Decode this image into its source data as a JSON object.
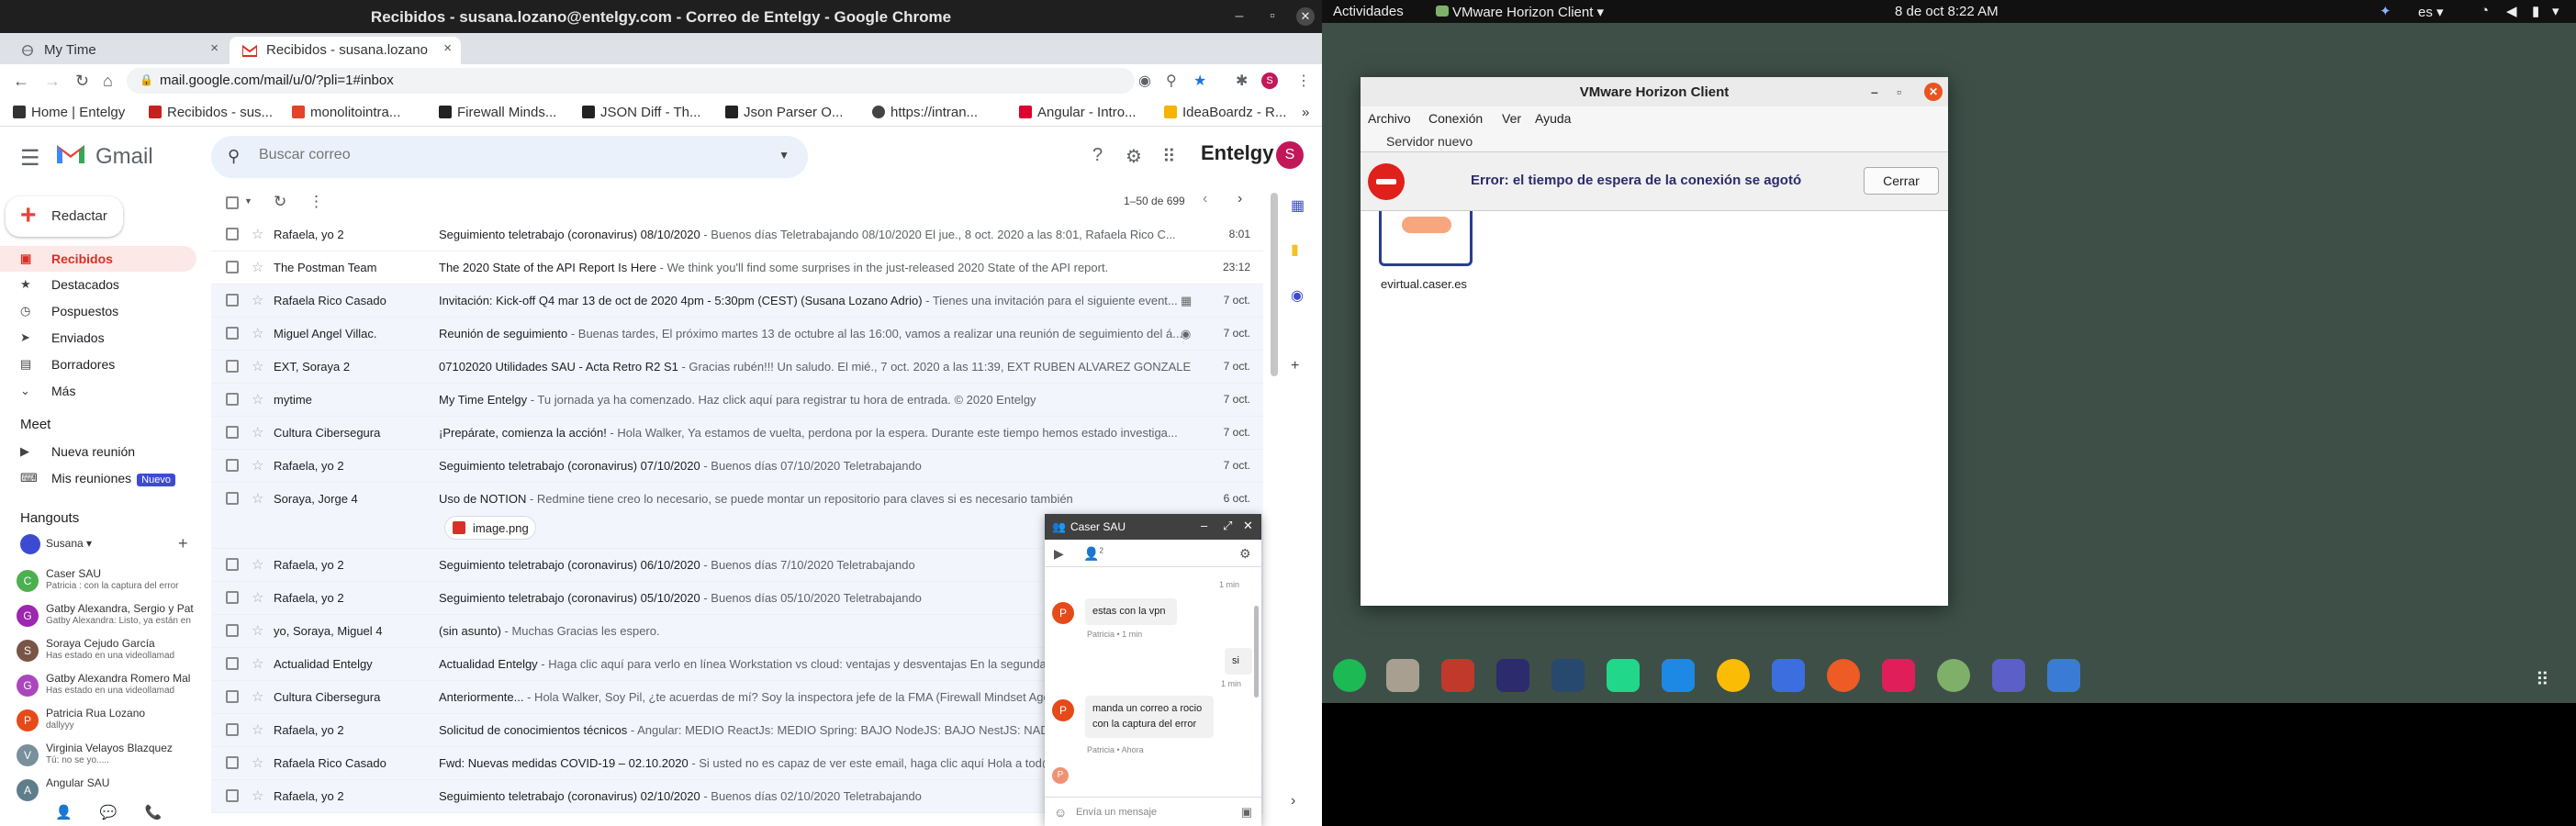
{
  "chrome": {
    "title": "Recibidos - susana.lozano@entelgy.com - Correo de Entelgy - Google Chrome",
    "tabs": [
      {
        "label": "My Time"
      },
      {
        "label": "Recibidos - susana.lozano"
      }
    ],
    "url": "mail.google.com/mail/u/0/?pli=1#inbox",
    "bookmarks": [
      {
        "label": "Home | Entelgy",
        "color": "#333"
      },
      {
        "label": "Recibidos - sus...",
        "color": "#c5221f"
      },
      {
        "label": "monolitointra...",
        "color": "#e24329"
      },
      {
        "label": "Firewall Minds...",
        "color": "#222"
      },
      {
        "label": "JSON Diff - Th...",
        "color": "#222"
      },
      {
        "label": "Json Parser O...",
        "color": "#222"
      },
      {
        "label": "https://intran...",
        "color": "#444"
      },
      {
        "label": "Angular - Intro...",
        "color": "#dd0031"
      },
      {
        "label": "IdeaBoardz - R...",
        "color": "#f4b400"
      }
    ]
  },
  "gmail": {
    "brand": "Gmail",
    "search_placeholder": "Buscar correo",
    "company_logo": "Entelgy",
    "avatar_letter": "S",
    "compose_label": "Redactar",
    "nav": [
      {
        "label": "Recibidos",
        "icon": "inbox-icon",
        "active": true
      },
      {
        "label": "Destacados",
        "icon": "star-icon"
      },
      {
        "label": "Pospuestos",
        "icon": "clock-icon"
      },
      {
        "label": "Enviados",
        "icon": "send-icon"
      },
      {
        "label": "Borradores",
        "icon": "draft-icon"
      },
      {
        "label": "Más",
        "icon": "chevron-down-icon"
      }
    ],
    "meet": {
      "title": "Meet",
      "new_meeting": "Nueva reunión",
      "my_meetings": "Mis reuniones",
      "badge": "Nuevo"
    },
    "hangouts": {
      "title": "Hangouts",
      "user": "Susana",
      "contacts": [
        {
          "name": "Caser SAU",
          "sub": "Patricia : con la captura del error",
          "color": "#4caf50",
          "letter": "C"
        },
        {
          "name": "Gatby Alexandra, Sergio y Pat",
          "sub": "Gatby Alexandra: Listo, ya están en",
          "color": "#9c27b0",
          "letter": "G"
        },
        {
          "name": "Soraya Cejudo García",
          "sub": "Has estado en una videollamad",
          "color": "#795548",
          "letter": "S"
        },
        {
          "name": "Gatby Alexandra Romero Mal",
          "sub": "Has estado en una videollamad",
          "color": "#ab47bc",
          "letter": "G"
        },
        {
          "name": "Patricia Rua Lozano",
          "sub": "dallyyy",
          "color": "#e64a19",
          "letter": "P"
        },
        {
          "name": "Virginia Velayos Blazquez",
          "sub": "Tú: no se yo.....",
          "color": "#78909c",
          "letter": "V"
        },
        {
          "name": "Angular SAU",
          "sub": "",
          "color": "#607d8b",
          "letter": "A"
        }
      ]
    },
    "pager": "1–50 de 699",
    "emails": [
      {
        "sender": "Rafaela, yo 2",
        "subject": "Seguimiento teletrabajo (coronavirus) 08/10/2020",
        "snippet": " - Buenos días Teletrabajando 08/10/2020 El jue., 8 oct. 2020 a las 8:01, Rafaela Rico C...",
        "date": "8:01",
        "icon": ""
      },
      {
        "sender": "The Postman Team",
        "subject": "The 2020 State of the API Report Is Here",
        "snippet": " - We think you'll find some surprises in the just-released 2020 State of the API report.",
        "date": "23:12",
        "icon": ""
      },
      {
        "sender": "Rafaela Rico Casado",
        "subject": "Invitación: Kick-off Q4 mar 13 de oct de 2020 4pm - 5:30pm (CEST) (Susana Lozano Adrio)",
        "snippet": " - Tienes una invitación para el siguiente event...",
        "date": "7 oct.",
        "icon": "▦"
      },
      {
        "sender": "Miguel Angel Villac.",
        "subject": "Reunión de seguimiento",
        "snippet": " - Buenas tardes, El próximo martes 13 de octubre al las 16:00, vamos a realizar una reunión de seguimiento del á...",
        "date": "7 oct.",
        "icon": "◉"
      },
      {
        "sender": "EXT, Soraya 2",
        "subject": "07102020 Utilidades SAU - Acta Retro R2 S1",
        "snippet": " - Gracias rubén!!! Un saludo. El mié., 7 oct. 2020 a las 11:39, EXT RUBEN ALVAREZ GONZALE...",
        "date": "7 oct.",
        "icon": ""
      },
      {
        "sender": "mytime",
        "subject": "My Time Entelgy",
        "snippet": " - Tu jornada ya ha comenzado. Haz click aquí para registrar tu hora de entrada. © 2020 Entelgy",
        "date": "7 oct.",
        "icon": ""
      },
      {
        "sender": "Cultura Cibersegura",
        "subject": "¡Prepárate, comienza la acción!",
        "snippet": " - Hola Walker, Ya estamos de vuelta, perdona por la espera. Durante este tiempo hemos estado investiga...",
        "date": "7 oct.",
        "icon": ""
      },
      {
        "sender": "Rafaela, yo 2",
        "subject": "Seguimiento teletrabajo (coronavirus) 07/10/2020",
        "snippet": " - Buenos días 07/10/2020 Teletrabajando",
        "date": "7 oct.",
        "icon": ""
      },
      {
        "sender": "Soraya, Jorge 4",
        "subject": "Uso de NOTION",
        "snippet": " - Redmine tiene creo lo necesario, se puede montar un repositorio para claves si es necesario también",
        "date": "6 oct.",
        "icon": ""
      },
      {
        "sender": "Rafaela, yo 2",
        "subject": "Seguimiento teletrabajo (coronavirus) 06/10/2020",
        "snippet": " - Buenos días 7/10/2020 Teletrabajando",
        "date": "",
        "icon": ""
      },
      {
        "sender": "Rafaela, yo 2",
        "subject": "Seguimiento teletrabajo (coronavirus) 05/10/2020",
        "snippet": " - Buenos días 05/10/2020 Teletrabajando",
        "date": "",
        "icon": ""
      },
      {
        "sender": "yo, Soraya, Miguel 4",
        "subject": "(sin asunto)",
        "snippet": " - Muchas Gracias les espero.",
        "date": "",
        "icon": ""
      },
      {
        "sender": "Actualidad Entelgy",
        "subject": "Actualidad Entelgy",
        "snippet": " - Haga clic aquí para verlo en línea  Workstation vs cloud: ventajas y desventajas En la segunda r",
        "date": "",
        "icon": ""
      },
      {
        "sender": "Cultura Cibersegura",
        "subject": "Anteriormente...",
        "snippet": " - Hola Walker, Soy Pil, ¿te acuerdas de mí? Soy la inspectora jefe de la FMA (Firewall Mindset Agenc",
        "date": "",
        "icon": ""
      },
      {
        "sender": "Rafaela, yo 2",
        "subject": "Solicitud de conocimientos técnicos",
        "snippet": " - Angular: MEDIO ReactJs: MEDIO Spring: BAJO NodeJS: BAJO NestJS: NADA",
        "date": "",
        "icon": ""
      },
      {
        "sender": "Rafaela Rico Casado",
        "subject": "Fwd: Nuevas medidas COVID-19 – 02.10.2020",
        "snippet": " - Si usted no es capaz de ver este email, haga clic aquí Hola a tod@s",
        "date": "",
        "icon": ""
      },
      {
        "sender": "Rafaela, yo 2",
        "subject": "Seguimiento teletrabajo (coronavirus) 02/10/2020",
        "snippet": " - Buenos días 02/10/2020 Teletrabajando",
        "date": "",
        "icon": ""
      }
    ],
    "attachment": "image.png"
  },
  "chat": {
    "title": "Caser SAU",
    "participants": "2",
    "messages": [
      {
        "text": "estas con la vpn",
        "meta": "Patricia • 1 min",
        "side": "left"
      },
      {
        "text": "si",
        "meta": "1 min",
        "side": "right"
      },
      {
        "text": "manda un correo a rocio con la captura del error",
        "meta": "Patricia • Ahora",
        "side": "left"
      }
    ],
    "top_meta": "1 min",
    "avatar_letter": "P",
    "input_placeholder": "Envía un mensaje"
  },
  "ubuntu": {
    "activities": "Actividades",
    "app_menu": "VMware Horizon Client",
    "clock": "8 de oct  8:22 AM",
    "lang": "es"
  },
  "vmware": {
    "title": "VMware Horizon Client",
    "menu": [
      "Archivo",
      "Conexión",
      "Ver",
      "Ayuda"
    ],
    "new_server": "Servidor nuevo",
    "error": "Error: el tiempo de espera de la conexión se agotó",
    "close_button": "Cerrar",
    "server_name": "evirtual.caser.es"
  },
  "dock": [
    {
      "name": "spotify-icon",
      "color": "#1db954"
    },
    {
      "name": "files-icon",
      "color": "#a89f91"
    },
    {
      "name": "jetbrains-toolbox-icon",
      "color": "#c0392b"
    },
    {
      "name": "intellij-icon",
      "color": "#2b2b6e"
    },
    {
      "name": "mysql-workbench-icon",
      "color": "#27496d"
    },
    {
      "name": "pycharm-icon",
      "color": "#21d789"
    },
    {
      "name": "vscode-icon",
      "color": "#1e88e5"
    },
    {
      "name": "chrome-icon",
      "color": "#fbbc05"
    },
    {
      "name": "text-editor-icon",
      "color": "#3d6ee0"
    },
    {
      "name": "postman-icon",
      "color": "#ef5b25"
    },
    {
      "name": "slack-icon",
      "color": "#e01e5a"
    },
    {
      "name": "vmware-horizon-icon",
      "color": "#7fb069"
    },
    {
      "name": "teams-icon",
      "color": "#5b5fc7"
    },
    {
      "name": "nx-icon",
      "color": "#3a7bd5"
    }
  ]
}
